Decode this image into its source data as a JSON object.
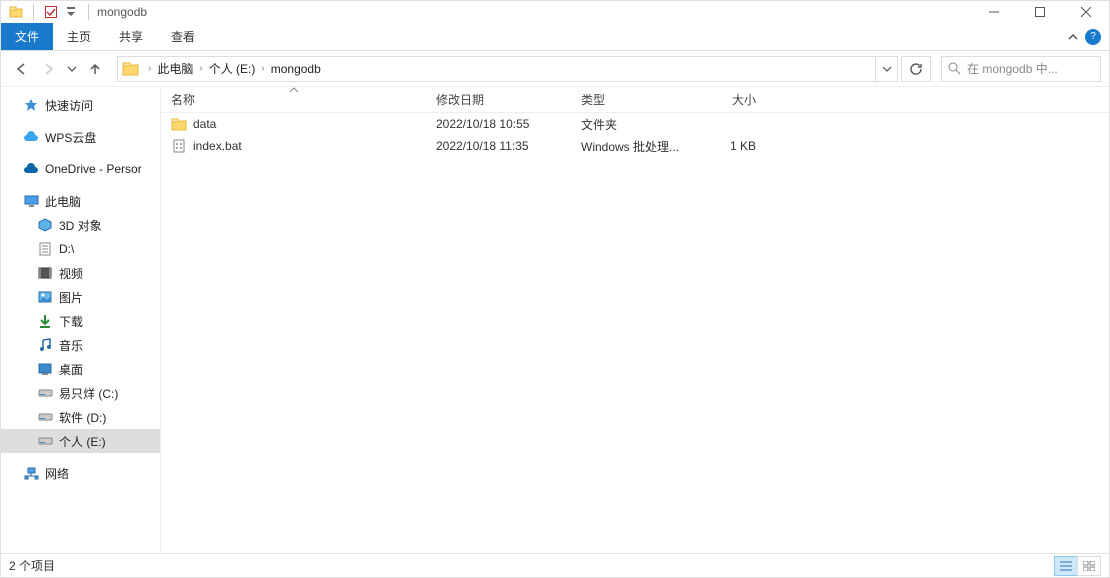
{
  "window": {
    "title": "mongodb"
  },
  "ribbon": {
    "file": "文件",
    "home": "主页",
    "share": "共享",
    "view": "查看"
  },
  "breadcrumbs": {
    "items": [
      {
        "label": "此电脑"
      },
      {
        "label": "个人 (E:)"
      },
      {
        "label": "mongodb"
      }
    ]
  },
  "search": {
    "placeholder": "在 mongodb 中..."
  },
  "sidebar": {
    "quick_access": "快速访问",
    "wps": "WPS云盘",
    "onedrive": "OneDrive - Persor",
    "this_pc": "此电脑",
    "items": [
      {
        "label": "3D 对象"
      },
      {
        "label": "D:\\"
      },
      {
        "label": "视频"
      },
      {
        "label": "图片"
      },
      {
        "label": "下载"
      },
      {
        "label": "音乐"
      },
      {
        "label": "桌面"
      },
      {
        "label": "易只烊 (C:)"
      },
      {
        "label": "软件 (D:)"
      },
      {
        "label": "个人 (E:)"
      }
    ],
    "network": "网络"
  },
  "columns": {
    "name": "名称",
    "modified": "修改日期",
    "type": "类型",
    "size": "大小"
  },
  "files": {
    "items": [
      {
        "name": "data",
        "modified": "2022/10/18 10:55",
        "type": "文件夹",
        "size": "",
        "icon": "folder"
      },
      {
        "name": "index.bat",
        "modified": "2022/10/18 11:35",
        "type": "Windows 批处理...",
        "size": "1 KB",
        "icon": "bat"
      }
    ]
  },
  "status": {
    "count": "2 个项目"
  }
}
